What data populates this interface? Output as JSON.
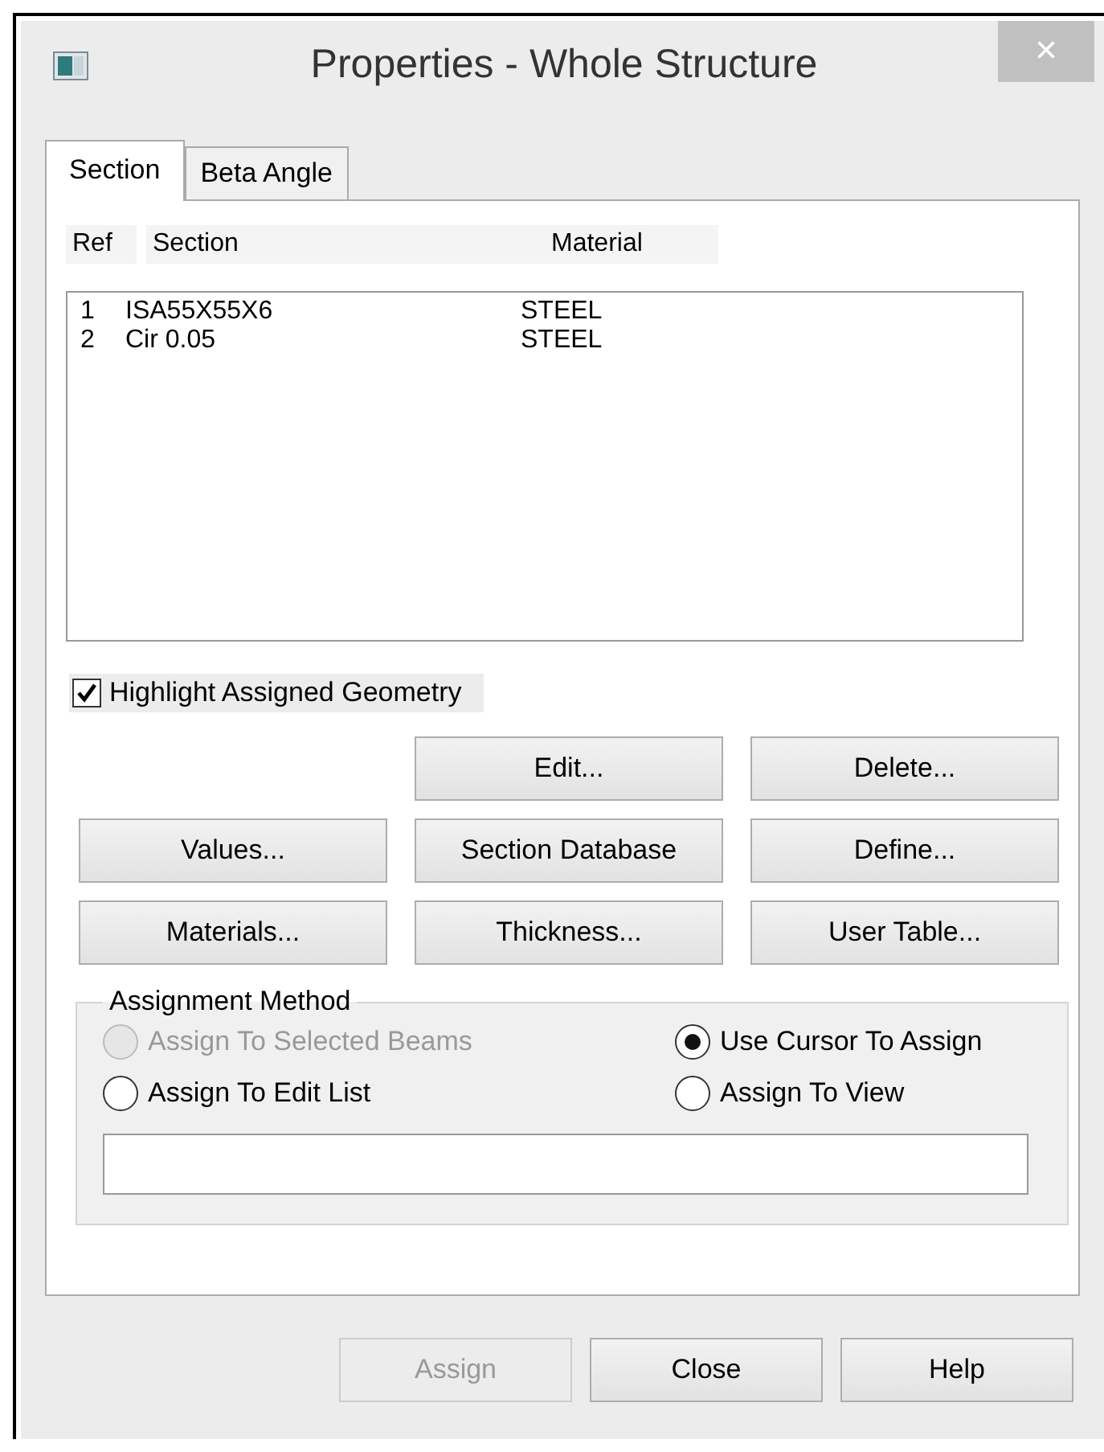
{
  "window": {
    "title": "Properties - Whole Structure",
    "close": "×"
  },
  "tabs": [
    {
      "label": "Section",
      "selected": true
    },
    {
      "label": "Beta Angle",
      "selected": false
    }
  ],
  "table": {
    "columns": [
      "Ref",
      "Section",
      "Material"
    ],
    "rows": [
      {
        "ref": "1",
        "section": "ISA55X55X6",
        "material": "STEEL"
      },
      {
        "ref": "2",
        "section": "Cir 0.05",
        "material": "STEEL"
      }
    ]
  },
  "highlight": {
    "label": "Highlight Assigned Geometry",
    "checked": true
  },
  "buttons": [
    "Edit...",
    "Delete...",
    "Values...",
    "Section Database",
    "Define...",
    "Materials...",
    "Thickness...",
    "User Table..."
  ],
  "assignment_method": {
    "title": "Assignment Method",
    "options": [
      {
        "label": "Assign To Selected Beams",
        "selected": false,
        "disabled": true
      },
      {
        "label": "Use Cursor To Assign",
        "selected": true,
        "disabled": false
      },
      {
        "label": "Assign To Edit List",
        "selected": false,
        "disabled": false
      },
      {
        "label": "Assign To View",
        "selected": false,
        "disabled": false
      }
    ]
  },
  "footer_buttons": [
    {
      "label": "Assign",
      "disabled": true
    },
    {
      "label": "Close",
      "disabled": false
    },
    {
      "label": "Help",
      "disabled": false
    }
  ]
}
